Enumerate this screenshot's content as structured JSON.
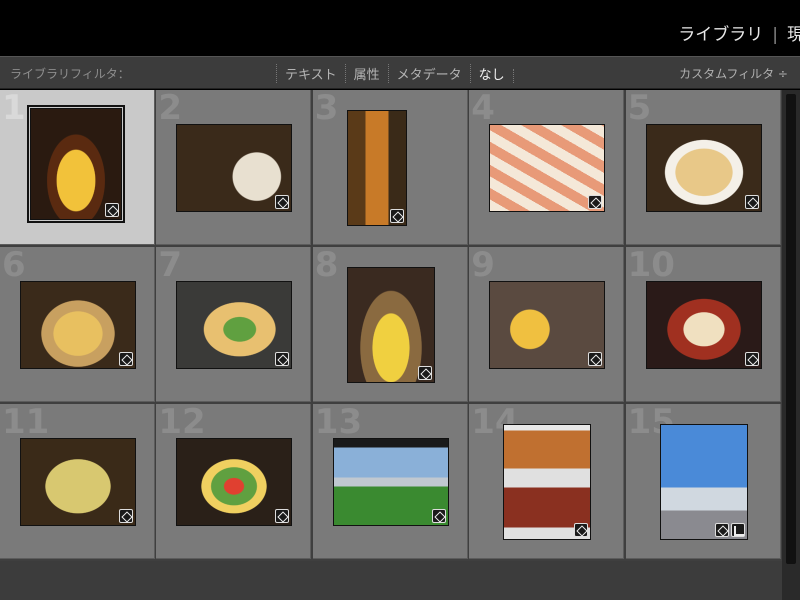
{
  "modules": {
    "library": "ライブラリ",
    "separator": "|",
    "develop": "現"
  },
  "filterbar": {
    "label": "ライブラリフィルタ：",
    "options": [
      "テキスト",
      "属性",
      "メタデータ",
      "なし"
    ],
    "active_option": "なし",
    "custom_filter": "カスタムフィルタ ÷"
  },
  "grid": {
    "columns": 5,
    "selected_index": 1,
    "cells": [
      {
        "index": 1,
        "badges": [
          "edit-icon"
        ]
      },
      {
        "index": 2,
        "badges": [
          "edit-icon"
        ]
      },
      {
        "index": 3,
        "badges": [
          "edit-icon"
        ]
      },
      {
        "index": 4,
        "badges": [
          "edit-icon"
        ]
      },
      {
        "index": 5,
        "badges": [
          "edit-icon"
        ]
      },
      {
        "index": 6,
        "badges": [
          "edit-icon"
        ]
      },
      {
        "index": 7,
        "badges": [
          "edit-icon"
        ]
      },
      {
        "index": 8,
        "badges": [
          "edit-icon"
        ]
      },
      {
        "index": 9,
        "badges": [
          "edit-icon"
        ]
      },
      {
        "index": 10,
        "badges": [
          "edit-icon"
        ]
      },
      {
        "index": 11,
        "badges": [
          "edit-icon"
        ]
      },
      {
        "index": 12,
        "badges": [
          "edit-icon"
        ]
      },
      {
        "index": 13,
        "badges": [
          "edit-icon"
        ]
      },
      {
        "index": 14,
        "badges": [
          "edit-icon"
        ]
      },
      {
        "index": 15,
        "badges": [
          "edit-icon",
          "crop-icon"
        ]
      }
    ]
  },
  "colors": {
    "cell_bg": "#7a7a7a",
    "selected_bg": "#c9c9c9",
    "panel_bg": "#3c3c3c"
  }
}
